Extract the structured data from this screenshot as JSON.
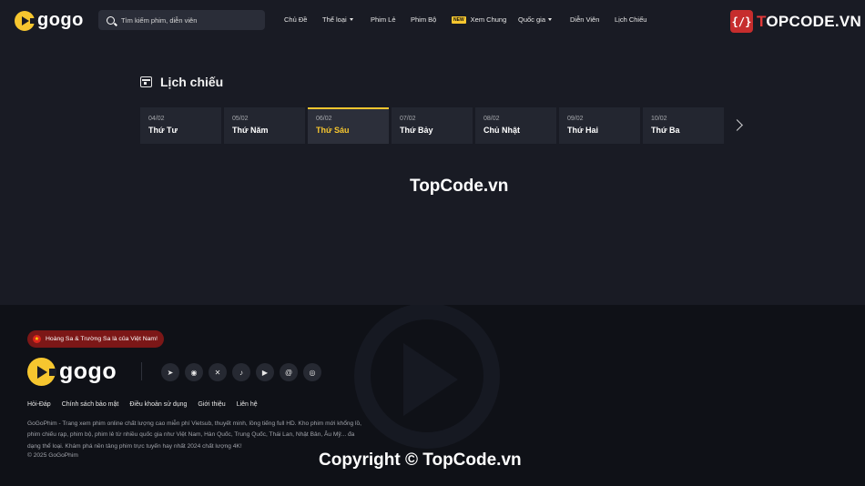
{
  "header": {
    "logo_text": "gogo",
    "search_placeholder": "Tìm kiếm phim, diễn viên",
    "nav": [
      {
        "label": "Chủ Đề"
      },
      {
        "label": "Thể loại"
      },
      {
        "label": "Phim Lẻ"
      },
      {
        "label": "Phim Bộ"
      },
      {
        "label": "Xem Chung",
        "badge": "NEW"
      },
      {
        "label": "Quốc gia"
      },
      {
        "label": "Diễn Viên"
      },
      {
        "label": "Lịch Chiếu"
      }
    ],
    "watermark_badge": {
      "icon": "{/}",
      "text_prefix": "T",
      "text_rest": "OPCODE.VN"
    }
  },
  "schedule": {
    "title": "Lịch chiếu",
    "days": [
      {
        "date": "04/02",
        "name": "Thứ Tư"
      },
      {
        "date": "05/02",
        "name": "Thứ Năm"
      },
      {
        "date": "06/02",
        "name": "Thứ Sáu",
        "active": true
      },
      {
        "date": "07/02",
        "name": "Thứ Bảy"
      },
      {
        "date": "08/02",
        "name": "Chủ Nhật"
      },
      {
        "date": "09/02",
        "name": "Thứ Hai"
      },
      {
        "date": "10/02",
        "name": "Thứ Ba"
      }
    ]
  },
  "watermarks": {
    "center": "TopCode.vn",
    "bottom": "Copyright © TopCode.vn"
  },
  "footer": {
    "badge": "Hoàng Sa & Trường Sa là của Việt Nam!",
    "flag_star": "★",
    "logo_text": "gogo",
    "socials": [
      {
        "icon": "telegram-icon",
        "glyph": "➤"
      },
      {
        "icon": "discord-icon",
        "glyph": "◉"
      },
      {
        "icon": "x-icon",
        "glyph": "✕"
      },
      {
        "icon": "tiktok-icon",
        "glyph": "♪"
      },
      {
        "icon": "youtube-icon",
        "glyph": "▶"
      },
      {
        "icon": "threads-icon",
        "glyph": "@"
      },
      {
        "icon": "instagram-icon",
        "glyph": "◎"
      }
    ],
    "links": [
      "Hỏi-Đáp",
      "Chính sách bảo mật",
      "Điều khoản sử dụng",
      "Giới thiệu",
      "Liên hệ"
    ],
    "description": "GoGoPhim - Trang xem phim online chất lượng cao miễn phí Vietsub, thuyết minh, lồng tiếng full HD. Kho phim mới khổng lồ, phim chiếu rạp, phim bộ, phim lẻ từ nhiều quốc gia như Việt Nam, Hàn Quốc, Trung Quốc, Thái Lan, Nhật Bản, Âu Mỹ... đa dạng thể loại. Khám phá nền tảng phim trực tuyến hay nhất 2024 chất lượng 4K!",
    "copyright": "© 2025 GoGoPhim"
  },
  "colors": {
    "accent": "#f6c62f",
    "background": "#191b24",
    "footer": "#0f1117",
    "badge_red": "#7c1717"
  }
}
